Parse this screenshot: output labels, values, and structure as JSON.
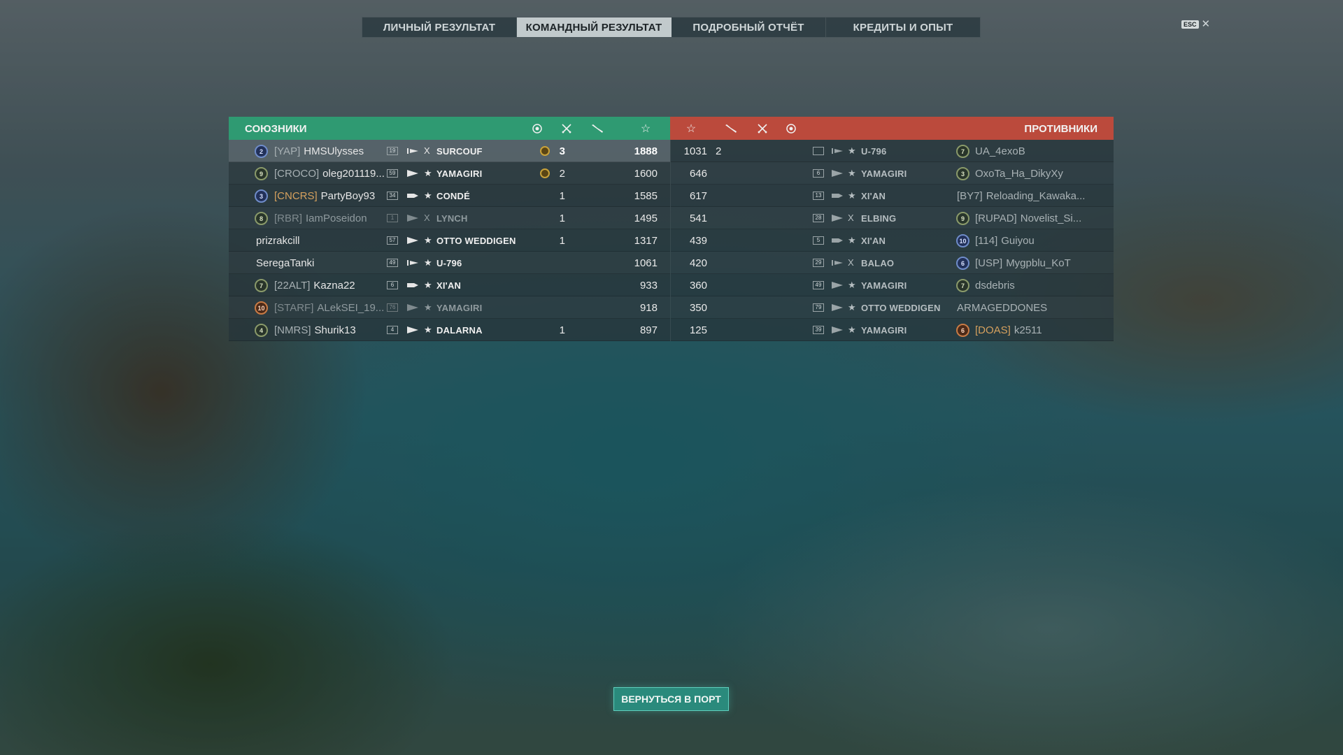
{
  "tabs": [
    {
      "label": "Личный результат",
      "active": false
    },
    {
      "label": "Командный результат",
      "active": true
    },
    {
      "label": "Подробный отчёт",
      "active": false
    },
    {
      "label": "Кредиты и опыт",
      "active": false
    }
  ],
  "esc": {
    "key": "ESC",
    "close": "✕"
  },
  "allies": {
    "title": "Союзники",
    "header_icons": [
      "laurel-icon",
      "crossed-swords-icon",
      "plane-icon",
      "star-icon"
    ],
    "players": [
      {
        "badge": "2",
        "badge_color": "blue",
        "clan": "[YAP]",
        "clan_gold": false,
        "name": "HMSUlysses",
        "level": "19",
        "ship_class": "submarine",
        "tier": "X",
        "ship": "SURCOUF",
        "medal": true,
        "kills": "3",
        "score": "1888",
        "me": true,
        "dead": false
      },
      {
        "badge": "9",
        "badge_color": "green",
        "clan": "[CROCO]",
        "clan_gold": false,
        "name": "oleg201119...",
        "level": "59",
        "ship_class": "destroyer",
        "tier": "★",
        "ship": "YAMAGIRI",
        "medal": true,
        "kills": "2",
        "score": "1600",
        "me": false,
        "dead": false
      },
      {
        "badge": "3",
        "badge_color": "blue",
        "clan": "[CNCRS]",
        "clan_gold": true,
        "name": "PartyBoy93",
        "level": "34",
        "ship_class": "cruiser",
        "tier": "★",
        "ship": "CONDÉ",
        "medal": false,
        "kills": "1",
        "score": "1585",
        "me": false,
        "dead": false
      },
      {
        "badge": "8",
        "badge_color": "green",
        "clan": "[RBR]",
        "clan_gold": false,
        "name": "IamPoseidon",
        "level": "1",
        "ship_class": "destroyer",
        "tier": "X",
        "ship": "LYNCH",
        "medal": false,
        "kills": "1",
        "score": "1495",
        "me": false,
        "dead": true
      },
      {
        "badge": "",
        "badge_color": "",
        "clan": "",
        "clan_gold": false,
        "name": "prizrakcill",
        "level": "57",
        "ship_class": "destroyer",
        "tier": "★",
        "ship": "OTTO WEDDIGEN",
        "medal": false,
        "kills": "1",
        "score": "1317",
        "me": false,
        "dead": false
      },
      {
        "badge": "",
        "badge_color": "",
        "clan": "",
        "clan_gold": false,
        "name": "SeregaTanki",
        "level": "49",
        "ship_class": "submarine",
        "tier": "★",
        "ship": "U-796",
        "medal": false,
        "kills": "",
        "score": "1061",
        "me": false,
        "dead": false
      },
      {
        "badge": "7",
        "badge_color": "green",
        "clan": "[22ALT]",
        "clan_gold": false,
        "name": "Kazna22",
        "level": "6",
        "ship_class": "cruiser",
        "tier": "★",
        "ship": "XI'AN",
        "medal": false,
        "kills": "",
        "score": "933",
        "me": false,
        "dead": false
      },
      {
        "badge": "10",
        "badge_color": "orange",
        "clan": "[STARF]",
        "clan_gold": false,
        "name": "ALekSEI_19...",
        "level": "76",
        "ship_class": "destroyer",
        "tier": "★",
        "ship": "YAMAGIRI",
        "medal": false,
        "kills": "",
        "score": "918",
        "me": false,
        "dead": true
      },
      {
        "badge": "4",
        "badge_color": "green",
        "clan": "[NMRS]",
        "clan_gold": false,
        "name": "Shurik13",
        "level": "4",
        "ship_class": "destroyer",
        "tier": "★",
        "ship": "DALARNA",
        "medal": false,
        "kills": "1",
        "score": "897",
        "me": false,
        "dead": false
      }
    ]
  },
  "enemies": {
    "title": "Противники",
    "header_icons": [
      "star-icon",
      "plane-icon",
      "crossed-swords-icon",
      "laurel-icon"
    ],
    "players": [
      {
        "score": "1031",
        "kills": "2",
        "level": "",
        "ship_class": "submarine",
        "tier": "★",
        "ship": "U-796",
        "badge": "7",
        "badge_color": "green",
        "clan": "",
        "clan_gold": false,
        "name": "UA_4exoB"
      },
      {
        "score": "646",
        "kills": "",
        "level": "6",
        "ship_class": "destroyer",
        "tier": "★",
        "ship": "YAMAGIRI",
        "badge": "3",
        "badge_color": "green",
        "clan": "",
        "clan_gold": false,
        "name": "OxoTa_Ha_DikyXy"
      },
      {
        "score": "617",
        "kills": "",
        "level": "13",
        "ship_class": "cruiser",
        "tier": "★",
        "ship": "XI'AN",
        "badge": "",
        "badge_color": "",
        "clan": "[BY7]",
        "clan_gold": false,
        "name": "Reloading_Kawaka..."
      },
      {
        "score": "541",
        "kills": "",
        "level": "28",
        "ship_class": "destroyer",
        "tier": "X",
        "ship": "ELBING",
        "badge": "9",
        "badge_color": "green",
        "clan": "[RUPAD]",
        "clan_gold": false,
        "name": "Novelist_Si..."
      },
      {
        "score": "439",
        "kills": "",
        "level": "5",
        "ship_class": "cruiser",
        "tier": "★",
        "ship": "XI'AN",
        "badge": "10",
        "badge_color": "blue",
        "clan": "[114]",
        "clan_gold": false,
        "name": "Guiyou"
      },
      {
        "score": "420",
        "kills": "",
        "level": "29",
        "ship_class": "submarine",
        "tier": "X",
        "ship": "BALAO",
        "badge": "6",
        "badge_color": "blue",
        "clan": "[USP]",
        "clan_gold": false,
        "name": "Mygpblu_KoT"
      },
      {
        "score": "360",
        "kills": "",
        "level": "49",
        "ship_class": "destroyer",
        "tier": "★",
        "ship": "YAMAGIRI",
        "badge": "7",
        "badge_color": "green",
        "clan": "",
        "clan_gold": false,
        "name": "dsdebris"
      },
      {
        "score": "350",
        "kills": "",
        "level": "79",
        "ship_class": "destroyer",
        "tier": "★",
        "ship": "OTTO WEDDIGEN",
        "badge": "",
        "badge_color": "",
        "clan": "",
        "clan_gold": false,
        "name": "ARMAGEDDONES"
      },
      {
        "score": "125",
        "kills": "",
        "level": "39",
        "ship_class": "destroyer",
        "tier": "★",
        "ship": "YAMAGIRI",
        "badge": "6",
        "badge_color": "orange",
        "clan": "[DOAS]",
        "clan_gold": true,
        "name": "k2511"
      }
    ]
  },
  "footer": {
    "back_label": "Вернуться в порт"
  },
  "colors": {
    "allies": "#2f9a72",
    "enemies": "#bb4a3c",
    "button": "#2a8a7c"
  }
}
